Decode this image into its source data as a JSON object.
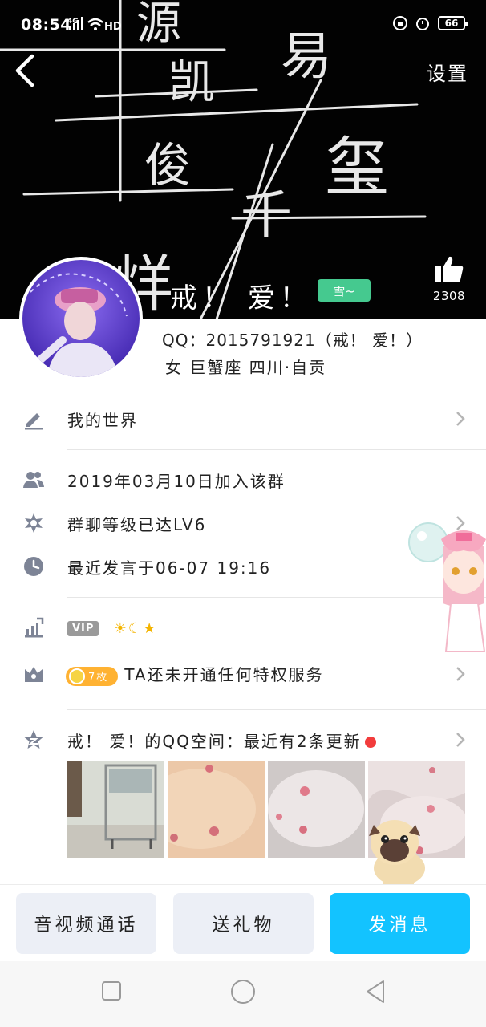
{
  "status_bar": {
    "time": "08:54",
    "network": "4G",
    "hd": "HD",
    "battery": "66"
  },
  "header": {
    "settings_label": "设置",
    "nickname": "戒！ 爱！",
    "tag": "雪~",
    "likes": "2308",
    "background_chars": [
      "源",
      "凯",
      "易",
      "俊",
      "玺",
      "千",
      "烊"
    ]
  },
  "profile": {
    "qq_line": "QQ：2015791921（戒！ 爱！）",
    "info_line": "女  巨蟹座  四川·自贡"
  },
  "rows": {
    "my_world": "我的世界",
    "join_date": "2019年03月10日加入该群",
    "level": "群聊等级已达LV6",
    "last_message": "最近发言于06-07 19:16",
    "vip_label": "VIP",
    "vip_icons": "☀☾★",
    "coin_count": "7枚",
    "privilege": "TA还未开通任何特权服务",
    "qzone": "戒！ 爱！的QQ空间：最近有2条更新"
  },
  "actions": {
    "call": "音视频通话",
    "gift": "送礼物",
    "message": "发消息"
  },
  "colors": {
    "accent": "#13c3ff",
    "badge_green": "#45c98f",
    "coin_orange": "#ffb232",
    "notify_red": "#f23c3c"
  }
}
